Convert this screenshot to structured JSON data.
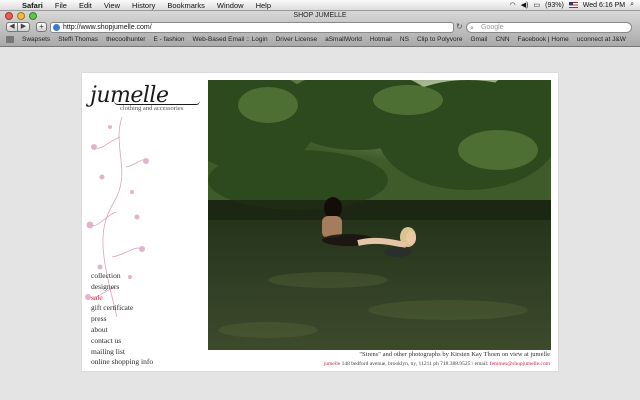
{
  "menubar": {
    "app": "Safari",
    "items": [
      "File",
      "Edit",
      "View",
      "History",
      "Bookmarks",
      "Window",
      "Help"
    ],
    "window_title": "SHOP JUMELLE",
    "battery": "(93%)",
    "clock": "Wed 6:16 PM"
  },
  "toolbar": {
    "back": "◀",
    "forward": "▶",
    "add": "+",
    "url": "http://www.shopjumelle.com/",
    "search_placeholder": "Google"
  },
  "bookmarks": [
    "Swapsets",
    "Steffi Thomas",
    "thecoolhunter",
    "E - fashion",
    "Web-Based Email :: Login",
    "Driver License",
    "aSmallWorld",
    "Hotmail",
    "NS",
    "Clip to Polyvore",
    "Gmail",
    "CNN",
    "Facebook | Home",
    "uconnect at J&W"
  ],
  "site": {
    "logo": "jumelle",
    "tagline": "clothing and accessories",
    "nav": [
      {
        "label": "collection",
        "active": false
      },
      {
        "label": "designers",
        "active": false
      },
      {
        "label": "sale",
        "active": true
      },
      {
        "label": "gift certificate",
        "active": false
      },
      {
        "label": "press",
        "active": false
      },
      {
        "label": "about",
        "active": false
      },
      {
        "label": "contact us",
        "active": false
      },
      {
        "label": "mailing list",
        "active": false
      },
      {
        "label": "online shopping info",
        "active": false
      }
    ],
    "caption": "\"Sirens\" and other photographs by Kirsten Kay Thoen on view at jumelle",
    "address_brand": "jumelle",
    "address_text": " 148 bedford avenue, brooklyn, ny, 11211     ph 718.388.9525 / email: ",
    "email": "femmes@shopjumelle.com"
  },
  "colors": {
    "accent": "#c8264c",
    "page_bg": "#e4e4e4"
  }
}
